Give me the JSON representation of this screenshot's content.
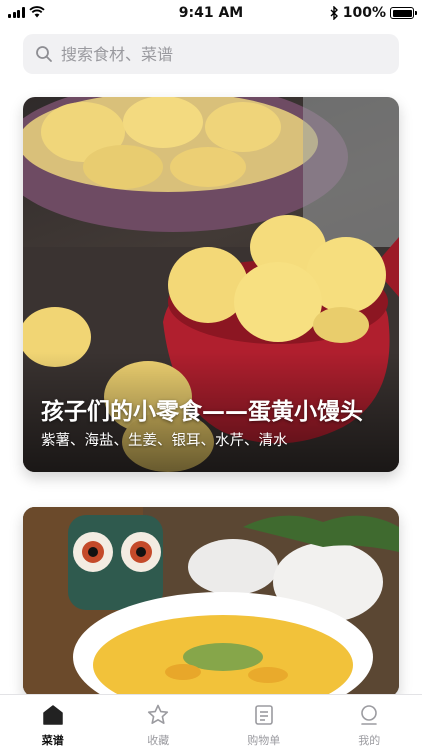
{
  "status_bar": {
    "time": "9:41 AM",
    "battery": "100%",
    "battery_level": 1.0
  },
  "search": {
    "placeholder": "搜索食材、菜谱",
    "value": ""
  },
  "recipes": [
    {
      "title": "孩子们的小零食——蛋黄小馒头",
      "ingredients": "紫薯、海盐、生姜、银耳、水芹、清水"
    },
    {
      "title": "",
      "ingredients": ""
    }
  ],
  "tabs": [
    {
      "label": "菜谱",
      "icon": "home-icon",
      "active": true
    },
    {
      "label": "收藏",
      "icon": "star-icon",
      "active": false
    },
    {
      "label": "购物单",
      "icon": "list-icon",
      "active": false
    },
    {
      "label": "我的",
      "icon": "profile-icon",
      "active": false
    }
  ],
  "colors": {
    "active_tab": "#111111",
    "inactive_tab": "#9b9ba0",
    "search_bg": "#f1f1f3"
  }
}
